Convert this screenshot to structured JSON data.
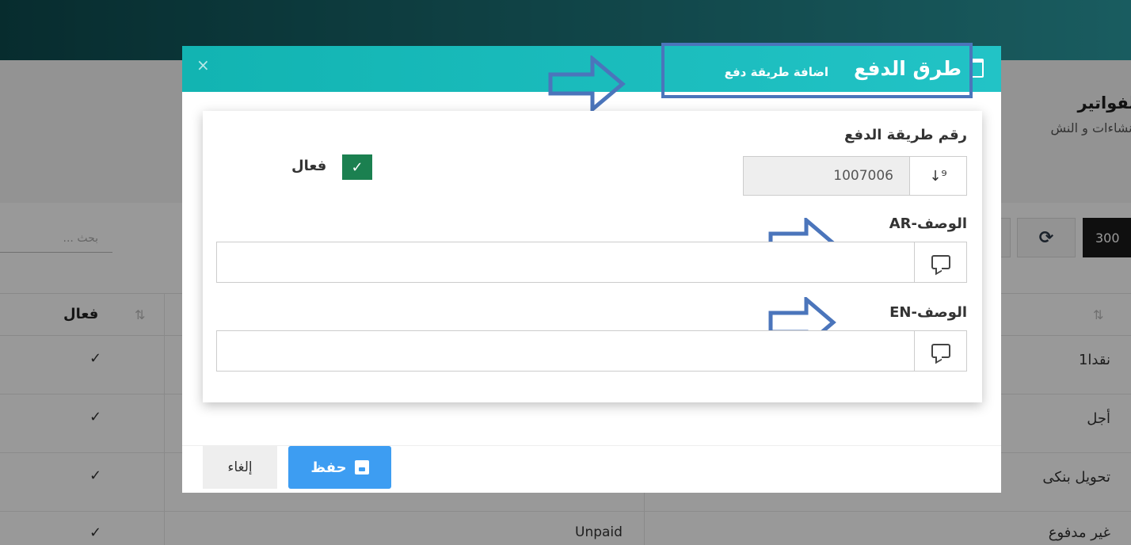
{
  "background": {
    "page_title": "للفواتير",
    "page_subtitle": "للانشاءات و النش",
    "search_placeholder": "بحث ...",
    "page_size": "300",
    "refresh_icon": "refresh-icon",
    "table": {
      "active_header": "فعال",
      "rows": [
        {
          "name": "نقدا1",
          "en": "",
          "active": "✓"
        },
        {
          "name": "أجل",
          "en": "",
          "active": "✓"
        },
        {
          "name": "تحويل بنكى",
          "en": "",
          "active": "✓"
        },
        {
          "name": "غير مدفوع",
          "en": "Unpaid",
          "active": "✓"
        }
      ]
    }
  },
  "modal": {
    "close": "×",
    "title": "طرق الدفع",
    "subtitle": "اضافة طريقة دفع",
    "title_icon": "clipboard-icon",
    "number_label": "رقم طريقة الدفع",
    "number_value": "1007006",
    "number_icon": "sort-numeric-icon",
    "active_label": "فعال",
    "active_checked": true,
    "desc_ar_label": "الوصف-AR",
    "desc_ar_value": "",
    "desc_en_label": "الوصف-EN",
    "desc_en_value": "",
    "comment_icon": "comment-icon",
    "save_label": "حفظ",
    "cancel_label": "إلغاء"
  },
  "annotation_color": "#4b75bb",
  "accent_color": "#1db8b8"
}
